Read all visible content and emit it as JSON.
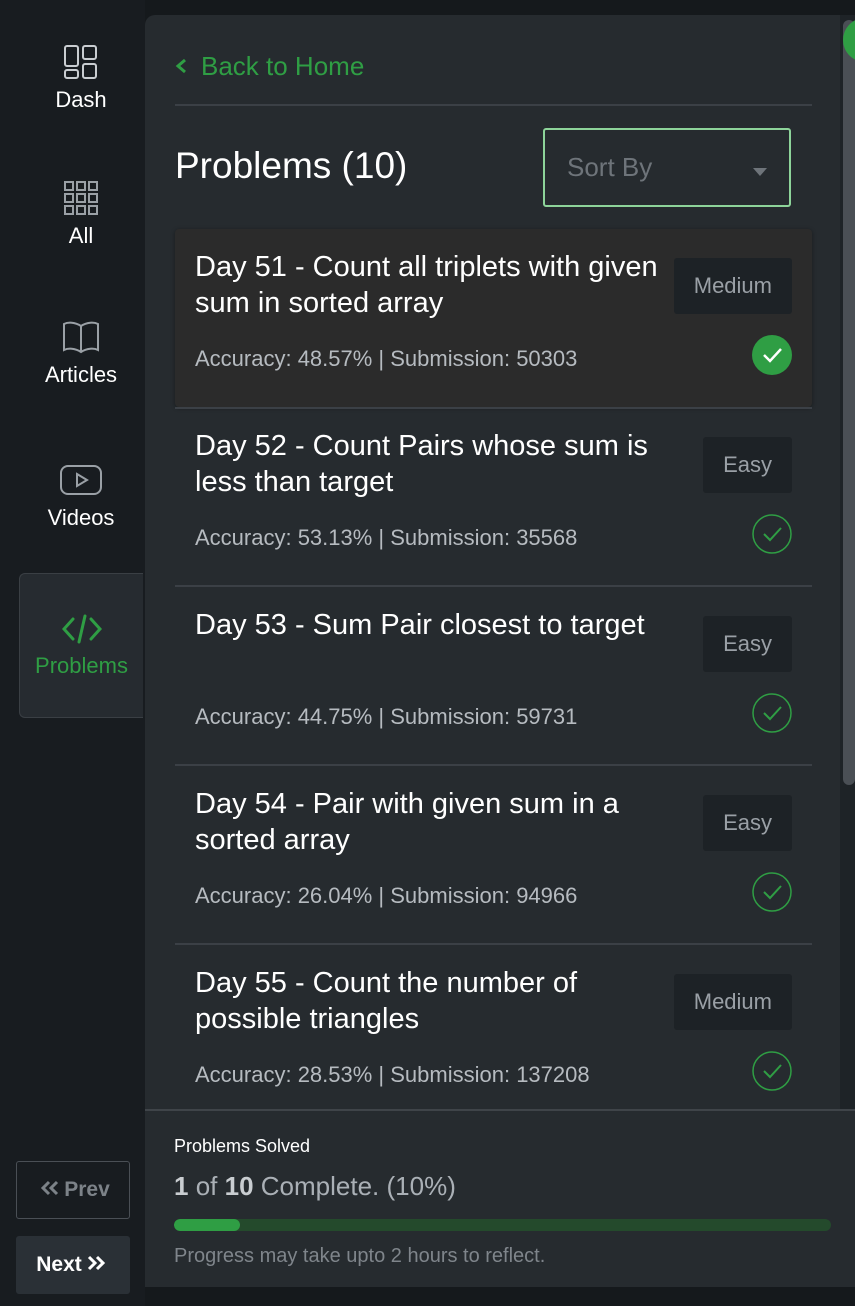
{
  "sidebar": {
    "items": [
      {
        "label": "Dash",
        "icon": "dashboard-icon"
      },
      {
        "label": "All",
        "icon": "grid-icon"
      },
      {
        "label": "Articles",
        "icon": "book-icon"
      },
      {
        "label": "Videos",
        "icon": "video-icon"
      },
      {
        "label": "Problems",
        "icon": "code-icon",
        "active": true
      }
    ],
    "prev_label": "Prev",
    "next_label": "Next"
  },
  "header": {
    "back_label": "Back to Home",
    "title": "Problems (10)",
    "sort_placeholder": "Sort By"
  },
  "problems": [
    {
      "title": "Day 51 - Count all triplets with given sum in sorted array",
      "difficulty": "Medium",
      "stats": "Accuracy: 48.57% | Submission: 50303",
      "solved": true
    },
    {
      "title": "Day 52 - Count Pairs whose sum is less than target",
      "difficulty": "Easy",
      "stats": "Accuracy: 53.13% | Submission: 35568",
      "solved": false
    },
    {
      "title": "Day 53 - Sum Pair closest to target",
      "difficulty": "Easy",
      "stats": "Accuracy: 44.75% | Submission: 59731",
      "solved": false
    },
    {
      "title": "Day 54 - Pair with given sum in a sorted array",
      "difficulty": "Easy",
      "stats": "Accuracy: 26.04% | Submission: 94966",
      "solved": false
    },
    {
      "title": "Day 55 - Count the number of possible triangles",
      "difficulty": "Medium",
      "stats": "Accuracy: 28.53% | Submission: 137208",
      "solved": false
    }
  ],
  "progress": {
    "label": "Problems Solved",
    "solved": "1",
    "of_text": "of",
    "total": "10",
    "complete_text": "Complete. (10%)",
    "fraction": 0.1,
    "note": "Progress may take upto 2 hours to reflect."
  },
  "colors": {
    "accent": "#2f9e44",
    "panel": "#262b2f",
    "sidebar": "#181c20"
  }
}
